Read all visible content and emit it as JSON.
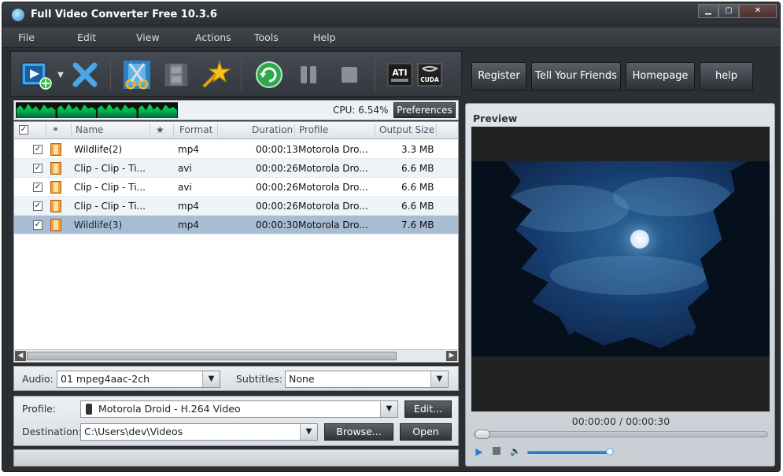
{
  "window": {
    "title": "Full Video Converter Free 10.3.6",
    "min_label": "▁",
    "max_label": "▢",
    "close_label": "✕"
  },
  "menu": [
    "File",
    "Edit",
    "View",
    "Actions",
    "Tools",
    "Help"
  ],
  "toolbar": {
    "icons": [
      "add-video-icon",
      "dropdown-arrow-icon",
      "remove-icon",
      "cut-icon",
      "merge-icon",
      "effects-wand-icon",
      "convert-icon",
      "pause-icon",
      "stop-icon",
      "ati-stream-icon",
      "nvidia-cuda-icon"
    ],
    "ati_label": "ATI",
    "cuda_label": "CUDA"
  },
  "stats": {
    "cpu": "CPU: 6.54%",
    "preferences": "Preferences"
  },
  "file_list": {
    "headers": [
      "Name",
      "★",
      "Format",
      "Duration",
      "Profile",
      "Output Size"
    ],
    "rows": [
      {
        "name": "Wildlife(2)",
        "format": "mp4",
        "duration": "00:00:13",
        "profile": "Motorola Dro...",
        "size": "3.3 MB",
        "checked": true,
        "selected": false
      },
      {
        "name": "Clip - Clip - Ti...",
        "format": "avi",
        "duration": "00:00:26",
        "profile": "Motorola Dro...",
        "size": "6.6 MB",
        "checked": true,
        "selected": false
      },
      {
        "name": "Clip - Clip - Ti...",
        "format": "avi",
        "duration": "00:00:26",
        "profile": "Motorola Dro...",
        "size": "6.6 MB",
        "checked": true,
        "selected": false
      },
      {
        "name": "Clip - Clip - Ti...",
        "format": "mp4",
        "duration": "00:00:26",
        "profile": "Motorola Dro...",
        "size": "6.6 MB",
        "checked": true,
        "selected": false
      },
      {
        "name": "Wildlife(3)",
        "format": "mp4",
        "duration": "00:00:30",
        "profile": "Motorola Dro...",
        "size": "7.6 MB",
        "checked": true,
        "selected": true
      }
    ]
  },
  "audio": {
    "label": "Audio:",
    "value": "01 mpeg4aac-2ch"
  },
  "subtitles": {
    "label": "Subtitles:",
    "value": "None"
  },
  "profile": {
    "label": "Profile:",
    "value": "Motorola Droid - H.264 Video",
    "edit": "Edit..."
  },
  "destination": {
    "label": "Destination:",
    "value": "C:\\Users\\dev\\Videos",
    "browse": "Browse...",
    "open": "Open"
  },
  "right_buttons": [
    "Register",
    "Tell Your Friends",
    "Homepage",
    "help"
  ],
  "preview": {
    "title": "Preview",
    "time": "00:00:00 / 00:00:30",
    "volume_fraction": 0.69
  },
  "colors": {
    "accent": "#3a93e0",
    "selected_row": "#a8bdd3",
    "convert_green": "#2ea84a"
  }
}
